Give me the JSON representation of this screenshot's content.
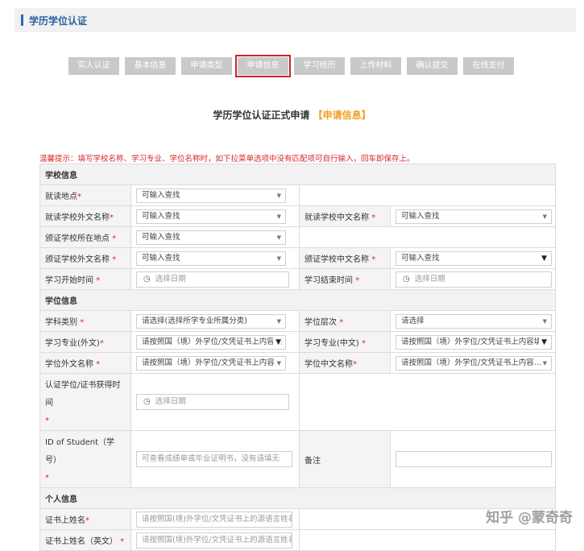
{
  "header": {
    "title": "学历学位认证"
  },
  "steps": [
    {
      "label": "实人认证"
    },
    {
      "label": "基本信息"
    },
    {
      "label": "申请类型"
    },
    {
      "label": "申请信息"
    },
    {
      "label": "学习经历"
    },
    {
      "label": "上传材料"
    },
    {
      "label": "确认提交"
    },
    {
      "label": "在线支付"
    }
  ],
  "heading": {
    "main": "学历学位认证正式申请",
    "highlight": "【申请信息】"
  },
  "tip": "温馨提示：填写学校名称、学习专业、学位名称时，如下拉菜单选项中没有匹配项可自行输入，回车即保存上。",
  "sections": {
    "school": "学校信息",
    "degree": "学位信息",
    "personal": "个人信息"
  },
  "fields": {
    "study_location": {
      "label": "就读地点",
      "value": "可输入查找"
    },
    "school_foreign": {
      "label": "就读学校外文名称",
      "value": "可输入查找"
    },
    "school_chinese": {
      "label": "就读学校中文名称",
      "value": "可输入查找"
    },
    "issuer_location": {
      "label": "颁证学校所在地点",
      "value": "可输入查找"
    },
    "issuer_foreign": {
      "label": "颁证学校外文名称",
      "value": "可输入查找"
    },
    "issuer_chinese": {
      "label": "颁证学校中文名称",
      "value": "可输入查找"
    },
    "study_start": {
      "label": "学习开始时间",
      "value": "选择日期"
    },
    "study_end": {
      "label": "学习结束时间",
      "value": "选择日期"
    },
    "discipline": {
      "label": "学科类别",
      "value": "请选择(选择所学专业所属分类)"
    },
    "degree_level": {
      "label": "学位层次",
      "value": "请选择"
    },
    "major_foreign": {
      "label": "学习专业(外文)",
      "value": "请按照国（境）外学位/文凭证书上内容填"
    },
    "major_chinese": {
      "label": "学习专业(中文)",
      "value": "请按照国（境）外学位/文凭证书上内容填"
    },
    "degree_foreign": {
      "label": "学位外文名称",
      "value": "请按照国（境）外学位/文凭证书上内容..."
    },
    "degree_chinese": {
      "label": "学位中文名称",
      "value": "请按照国（境）外学位/文凭证书上内容..."
    },
    "obtain_time": {
      "label": "认证学位/证书获得时间",
      "value": "选择日期"
    },
    "student_id": {
      "label": "ID of Student（学号）",
      "placeholder": "可查看成绩单或毕业证明书，没有请填无"
    },
    "remark": {
      "label": "备注",
      "value": ""
    },
    "cert_name": {
      "label": "证书上姓名",
      "placeholder": "请按照国(境)外学位/文凭证书上的源语言姓名填"
    },
    "cert_name_en": {
      "label": "证书上姓名（英文）",
      "placeholder": "请按照国(境)外学位/文凭证书上的源语言姓名填"
    }
  },
  "required_mark": "*",
  "watermark": "知乎 @蒙奇奇",
  "icons": {
    "dropdown": "triangle-down",
    "date": "clock-icon"
  },
  "colors": {
    "accent": "#2a6db0",
    "highlight": "#f0a020",
    "warning": "#d8262b",
    "active_step": "#c8262b"
  }
}
